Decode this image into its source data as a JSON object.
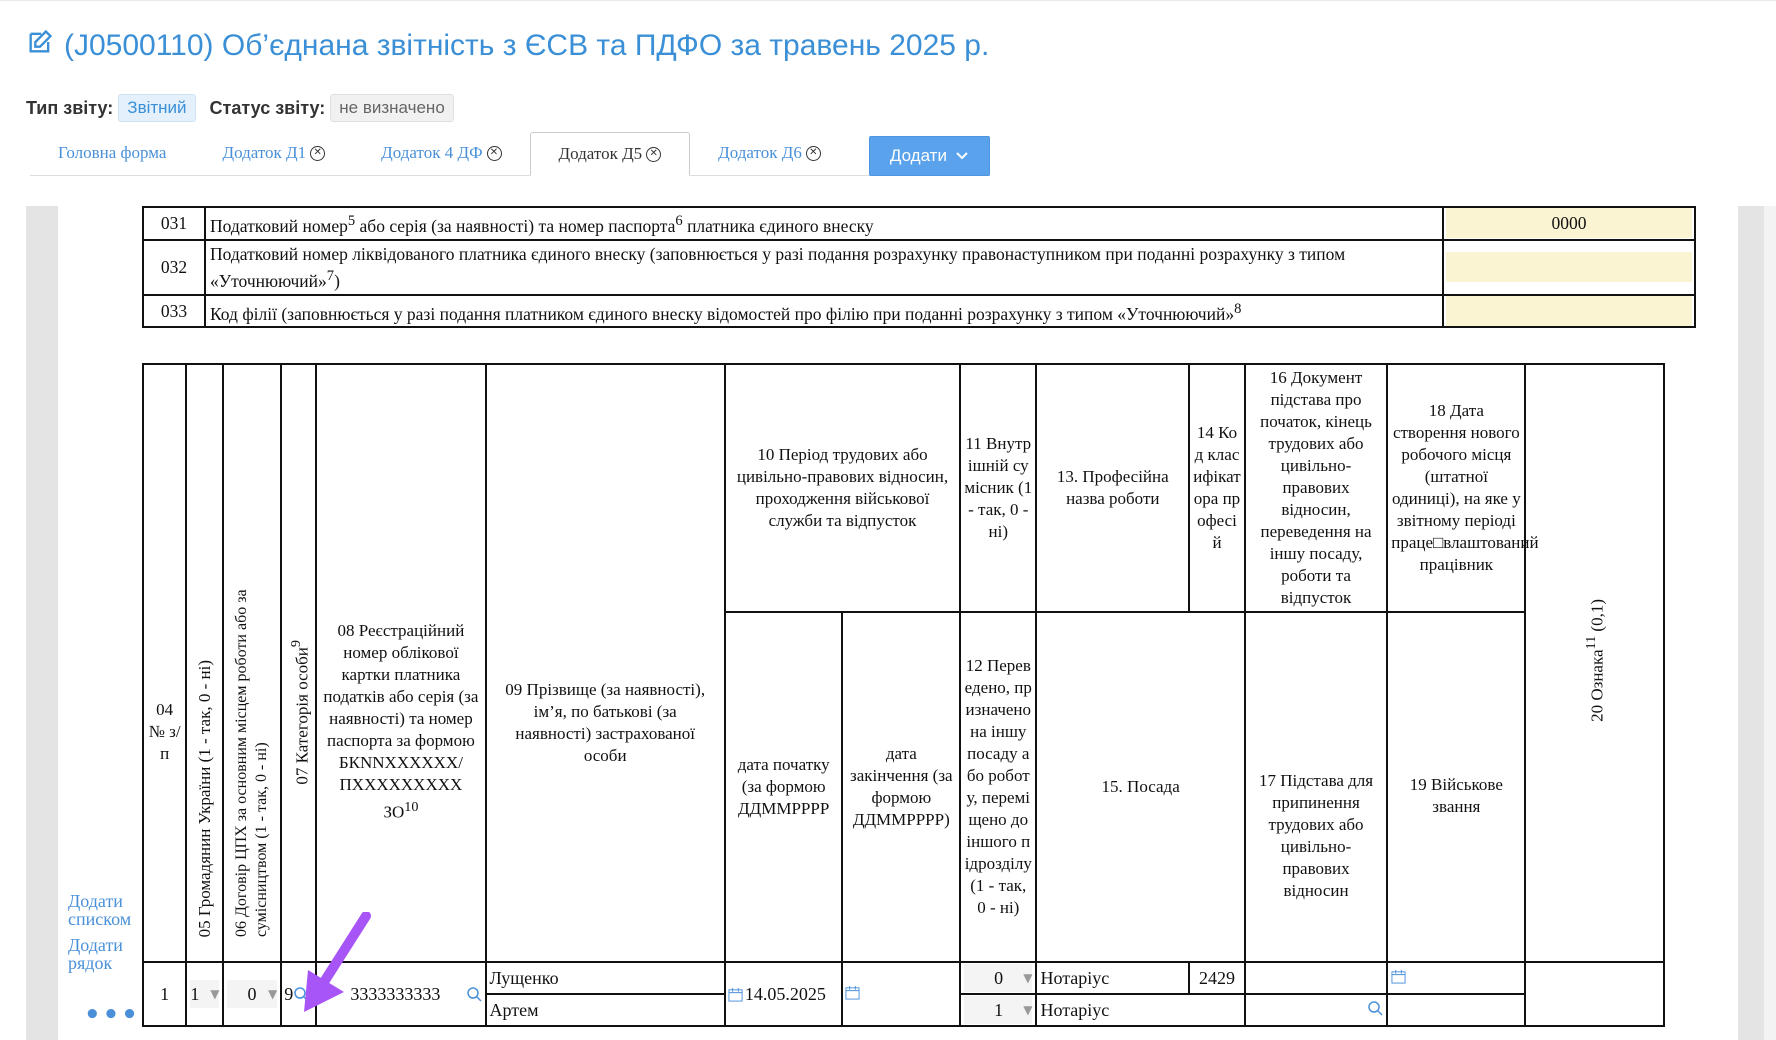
{
  "header": {
    "title": "(J0500110) Об’єднана звітність з ЄСВ та ПДФО за травень 2025 р.",
    "report_type_label": "Тип звіту:",
    "report_type_value": "Звітний",
    "status_label": "Статус звіту:",
    "status_value": "не визначено"
  },
  "tabs": [
    {
      "label": "Головна форма",
      "closable": false
    },
    {
      "label": "Додаток Д1",
      "closable": true
    },
    {
      "label": "Додаток 4 ДФ",
      "closable": true
    },
    {
      "label": "Додаток Д5",
      "closable": true,
      "active": true
    },
    {
      "label": "Додаток Д6",
      "closable": true
    }
  ],
  "add_button_label": "Додати",
  "top_rows": [
    {
      "code": "031",
      "text": "Податковий номер",
      "sup1": "5",
      "text2": " або серія (за наявності) та номер паспорта",
      "sup2": "6",
      "text3": " платника єдиного внеску",
      "value": "0000"
    },
    {
      "code": "032",
      "text": "Податковий номер ліквідованого платника єдиного внеску (заповнюється у разі подання розрахунку правонаступником при поданні розрахунку з типом «Уточнюючий»",
      "sup1": "7",
      "text2": ")",
      "value": ""
    },
    {
      "code": "033",
      "text": "Код філії (заповнюється у разі подання платником єдиного внеску відомостей про філію при поданні розрахунку з типом «Уточнюючий»",
      "sup1": "8",
      "value": ""
    }
  ],
  "columns": {
    "c04": "04 № з/п",
    "c05": "05 Громадянин України (1 - так, 0 - ні)",
    "c06": "06 Договір ЦПХ за основним місцем роботи або за сумісництвом (1 - так, 0 - ні)",
    "c07": "07 Категорія особи",
    "c07_sup": "9",
    "c08": "08 Реєстраційний номер облікової картки платника податків або серія (за наявності) та номер паспорта за формою БКNNXXXXXX/ ПXXXXXXXXX ЗО",
    "c08_sup": "10",
    "c09": "09 Прізвище (за наявності), ім’я, по батькові (за наявності) застрахованої особи",
    "c10": "10 Період трудових або цивільно-правових відносин, проходження військової служби та відпусток",
    "c10_start": "дата початку (за формою ДДММРРРР",
    "c10_end": "дата закінчення (за формою ДДММРРРР)",
    "c11": "11 Внутрішній сумісник (1 - так, 0 - ні)",
    "c12": "12 Переведено, призначено на іншу посаду або роботу, переміщено до іншого підрозділу (1 - так, 0 - ні)",
    "c13": "13. Професійна назва роботи",
    "c14": "14 Код класифікатора професій",
    "c15": "15. Посада",
    "c16": "16 Документ підстава про початок, кінець трудових або цивільно-правових відносин, переведення на іншу посаду, роботи та відпусток",
    "c17": "17 Підстава для припинення трудових або цивільно-правових відносин",
    "c18": "18 Дата створення нового робочого місця (штатної одиниці), на яке у звітному періоді праце□влаштований працівник",
    "c19": "19 Військове звання",
    "c20": "20 Ознака",
    "c20_sup": "11",
    "c20_tail": " (0,1)"
  },
  "row1": {
    "num": "1",
    "citizen": "1",
    "contract": "0",
    "category": "9",
    "tax_id": "3333333333",
    "last_name": "Лущенко",
    "first_name": "Артем",
    "start_date": "14.05.2025",
    "internal": "0",
    "transferred": "1",
    "prof_name_1": "Нотаріус",
    "prof_name_2": "Нотаріус",
    "classifier_code": "2429"
  },
  "left_links": {
    "add_list": "Додати списком",
    "add_row": "Додати рядок",
    "more": "•••"
  },
  "colors": {
    "accent": "#3a8fd6",
    "field_yellow": "#fbf4d2",
    "arrow": "#a855f7"
  }
}
